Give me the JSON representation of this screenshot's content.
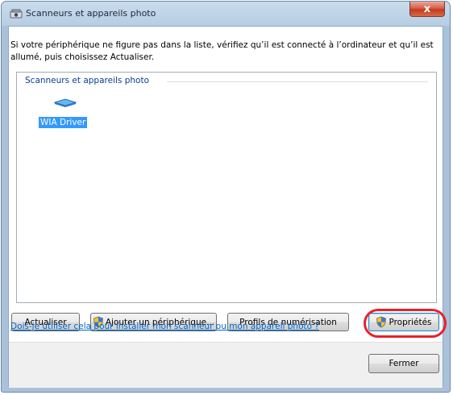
{
  "window": {
    "title": "Scanneurs et appareils photo",
    "close_glyph": "x"
  },
  "intro_text": "Si votre périphérique ne figure pas dans la liste, vérifiez qu’il est connecté à l’ordinateur et qu’il est allumé, puis choisissez Actualiser.",
  "group": {
    "title": "Scanneurs et appareils photo",
    "devices": [
      {
        "label": "WIA Driver",
        "icon": "scanner-icon",
        "selected": true
      }
    ]
  },
  "buttons": {
    "refresh": "Actualiser",
    "add_device": "Ajouter un périphérique...",
    "scan_profiles": "Profils de numérisation",
    "properties": "Propriétés",
    "close": "Fermer"
  },
  "help_link": "Dois-je utiliser cela pour installer mon scanneur ou mon appareil photo ?",
  "colors": {
    "selection": "#3399ff",
    "link": "#0066cc",
    "highlight_ring": "#e8212b"
  }
}
